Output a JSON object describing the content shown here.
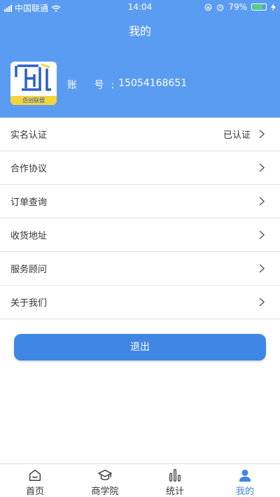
{
  "status_bar": {
    "carrier": "中国联通",
    "time": "14:04",
    "battery": "79%"
  },
  "header": {
    "title": "我的",
    "logo_text": "佰创联盟",
    "account_label": "账 号:",
    "account_value": "15054168651"
  },
  "menu": [
    {
      "label": "实名认证",
      "value": "已认证"
    },
    {
      "label": "合作协议",
      "value": ""
    },
    {
      "label": "订单查询",
      "value": ""
    },
    {
      "label": "收货地址",
      "value": ""
    },
    {
      "label": "服务顾问",
      "value": ""
    },
    {
      "label": "关于我们",
      "value": ""
    }
  ],
  "logout_label": "退出",
  "tabs": [
    {
      "label": "首页",
      "icon": "home-icon"
    },
    {
      "label": "商学院",
      "icon": "graduation-cap-icon"
    },
    {
      "label": "统计",
      "icon": "stats-icon"
    },
    {
      "label": "我的",
      "icon": "user-icon"
    }
  ],
  "colors": {
    "header_bg": "#5a9cf1",
    "accent": "#3f87e4",
    "logo_strip": "#f5d33b"
  }
}
